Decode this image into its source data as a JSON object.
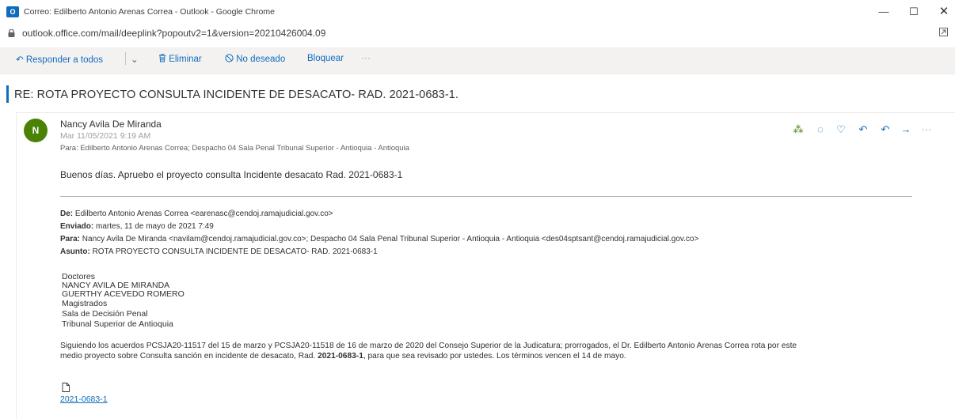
{
  "window": {
    "title": "Correo: Edilberto Antonio Arenas Correa - Outlook - Google Chrome",
    "app_badge": "O",
    "controls": {
      "minimize": "—",
      "maximize": "☐",
      "close": "✕"
    }
  },
  "address_bar": {
    "url": "outlook.office.com/mail/deeplink?popoutv2=1&version=20210426004.09"
  },
  "toolbar": {
    "reply_all_label": "Responder a todos",
    "delete_label": "Eliminar",
    "junk_label": "No deseado",
    "block_label": "Bloquear",
    "more_label": "···"
  },
  "message": {
    "subject": "RE: ROTA PROYECTO CONSULTA INCIDENTE DE DESACATO- RAD. 2021-0683-1.",
    "avatar_initial": "N",
    "avatar_color": "#498205",
    "sender_name": "Nancy Avila De Miranda",
    "date": "Mar 11/05/2021 9:19 AM",
    "to_line": "Para: Edilberto Antonio Arenas Correa; Despacho 04 Sala Penal Tribunal Superior - Antioquia - Antioquia",
    "greeting": "Buenos días. Apruebo el proyecto consulta Incidente desacato Rad. 2021-0683-1"
  },
  "forwarded": {
    "from_label": "De:",
    "from_value": "Edilberto Antonio Arenas Correa <earenasc@cendoj.ramajudicial.gov.co>",
    "sent_label": "Enviado:",
    "sent_value": "martes, 11 de mayo de 2021 7:49",
    "to_label": "Para:",
    "to_value": "Nancy Avila De Miranda <navilam@cendoj.ramajudicial.gov.co>; Despacho 04 Sala Penal Tribunal Superior - Antioquia - Antioquia <des04sptsant@cendoj.ramajudicial.gov.co>",
    "subject_label": "Asunto:",
    "subject_value": "ROTA PROYECTO CONSULTA INCIDENTE DE DESACATO- RAD. 2021-0683-1"
  },
  "signature": {
    "lines": [
      "Doctores",
      "NANCY AVILA DE MIRANDA",
      "GUERTHY ACEVEDO ROMERO",
      "Magistrados",
      "Sala de Decisión Penal",
      "Tribunal Superior de Antioquia"
    ]
  },
  "body": {
    "line1": "Siguiendo los acuerdos PCSJA20-11517 del 15 de marzo y PCSJA20-11518 de 16 de marzo de 2020 del Consejo Superior de la Judicatura; prorrogados, el Dr. Edilberto Antonio Arenas Correa rota por este",
    "line2_pre": "medio proyecto sobre Consulta sanción en incidente de desacato, Rad. ",
    "line2_bold": "2021-0683-1",
    "line2_post": ", para que sea revisado por ustedes.  Los términos vencen el 14 de mayo."
  },
  "attachment": {
    "name": "2021-0683-1"
  },
  "icons": {
    "lock": "lock-icon",
    "reply_all": "reply-all-icon",
    "delete": "trash-icon",
    "junk": "block-icon",
    "attachment": "document-icon"
  },
  "colors": {
    "accent": "#0f6cbd",
    "toolbar_bg": "#f3f2f1"
  }
}
